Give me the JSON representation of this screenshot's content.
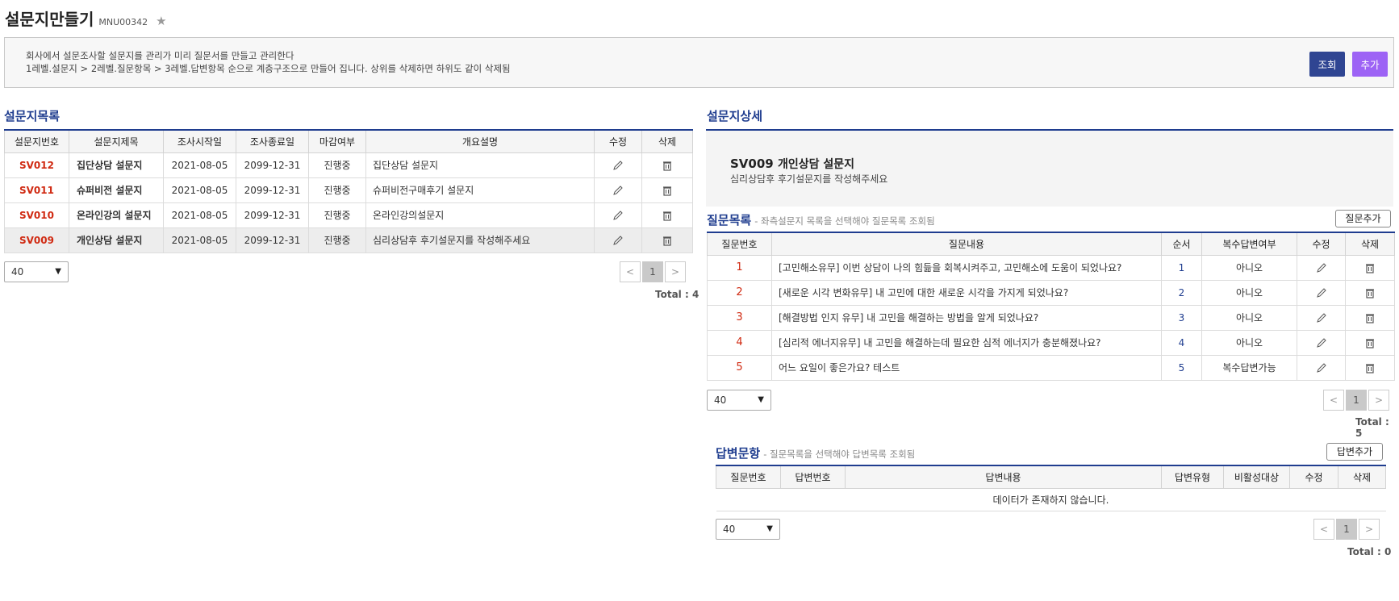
{
  "header": {
    "title": "설문지만들기",
    "menu_code": "MNU00342"
  },
  "info": {
    "line1": "회사에서 설문조사할 설문지를 관리가 미리 질문서를 만들고 관리한다",
    "line2": "1레벨.설문지 > 2레벨.질문항목 > 3레벨.답변항목 순으로 계층구조으로 만들어 집니다. 상위를 삭제하면 하위도 같이 삭제됨",
    "search_label": "조회",
    "add_label": "추가"
  },
  "survey_list": {
    "title": "설문지목록",
    "columns": [
      "설문지번호",
      "설문지제목",
      "조사시작일",
      "조사종료일",
      "마감여부",
      "개요설명",
      "수정",
      "삭제"
    ],
    "rows": [
      {
        "code": "SV012",
        "title": "집단상담 설문지",
        "start": "2021-08-05",
        "end": "2099-12-31",
        "status": "진행중",
        "desc": "집단상담 설문지"
      },
      {
        "code": "SV011",
        "title": "슈퍼비전 설문지",
        "start": "2021-08-05",
        "end": "2099-12-31",
        "status": "진행중",
        "desc": "슈퍼비전구매후기 설문지"
      },
      {
        "code": "SV010",
        "title": "온라인강의 설문지",
        "start": "2021-08-05",
        "end": "2099-12-31",
        "status": "진행중",
        "desc": "온라인강의설문지"
      },
      {
        "code": "SV009",
        "title": "개인상담 설문지",
        "start": "2021-08-05",
        "end": "2099-12-31",
        "status": "진행중",
        "desc": "심리상담후 후기설문지를 작성해주세요"
      }
    ],
    "page_size": "40",
    "page": "1",
    "prev": "<",
    "next": ">",
    "total": "Total : 4"
  },
  "survey_detail": {
    "title": "설문지상세",
    "code": "SV009",
    "name": "개인상담 설문지",
    "desc": "심리상담후 후기설문지를 작성해주세요"
  },
  "question_list": {
    "title": "질문목록",
    "hint": "- 좌측설문지 목록을 선택해야 질문목록 조회됨",
    "add_label": "질문추가",
    "columns": [
      "질문번호",
      "질문내용",
      "순서",
      "복수답변여부",
      "수정",
      "삭제"
    ],
    "rows": [
      {
        "no": "1",
        "content": "[고민해소유무] 이번 상담이 나의 힘듦을 회복시켜주고, 고민해소에 도움이 되었나요?",
        "order": "1",
        "multi": "아니오"
      },
      {
        "no": "2",
        "content": "[새로운 시각 변화유무] 내 고민에 대한 새로운 시각을 가지게 되었나요?",
        "order": "2",
        "multi": "아니오"
      },
      {
        "no": "3",
        "content": "[해결방법 인지 유무] 내 고민을 해결하는 방법을 알게 되었나요?",
        "order": "3",
        "multi": "아니오"
      },
      {
        "no": "4",
        "content": "[심리적 에너지유무] 내 고민을 해결하는데 필요한 심적 에너지가 충분해졌나요?",
        "order": "4",
        "multi": "아니오"
      },
      {
        "no": "5",
        "content": "어느 요일이 좋은가요? 테스트",
        "order": "5",
        "multi": "복수답변가능"
      }
    ],
    "page_size": "40",
    "page": "1",
    "prev": "<",
    "next": ">",
    "total": "Total : 5"
  },
  "answer_list": {
    "title": "답변문항",
    "hint": "- 질문목록을 선택해야 답변목록 조회됨",
    "add_label": "답변추가",
    "columns": [
      "질문번호",
      "답변번호",
      "답변내용",
      "답변유형",
      "비활성대상",
      "수정",
      "삭제"
    ],
    "empty": "데이터가 존재하지 않습니다.",
    "page_size": "40",
    "page": "1",
    "prev": "<",
    "next": ">",
    "total": "Total : 0"
  }
}
